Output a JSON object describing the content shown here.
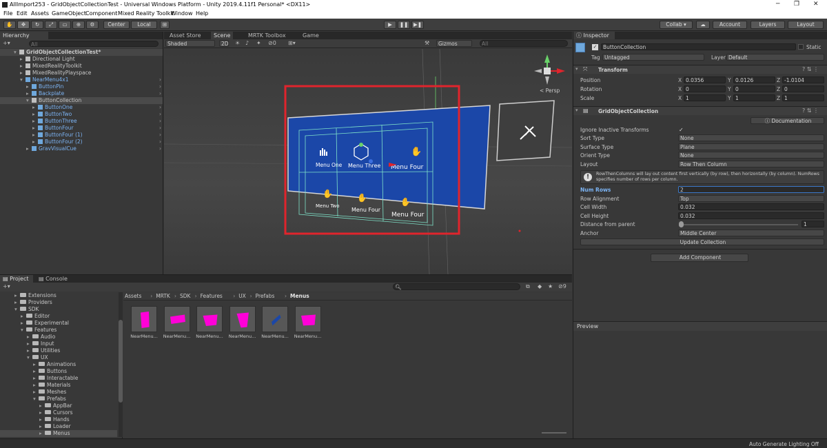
{
  "window": {
    "title": "AllImport253 - GridObjectCollectionTest - Universal Windows Platform - Unity 2019.4.11f1 Personal* <DX11>",
    "controls": [
      "─",
      "❐",
      "✕"
    ]
  },
  "menu": [
    "File",
    "Edit",
    "Assets",
    "GameObject",
    "Component",
    "Mixed Reality Toolkit",
    "Window",
    "Help"
  ],
  "toolbar": {
    "pivot": "Center",
    "space": "Local",
    "collab": "Collab ▾",
    "account": "Account",
    "layers": "Layers",
    "layout": "Layout"
  },
  "hierarchy": {
    "tab": "Hierarchy",
    "search_placeholder": "All",
    "scene": "GridObjectCollectionTest*",
    "items": [
      {
        "label": "Directional Light",
        "depth": 1,
        "prefab": false
      },
      {
        "label": "MixedRealityToolkit",
        "depth": 1,
        "prefab": false
      },
      {
        "label": "MixedRealityPlayspace",
        "depth": 1,
        "prefab": false
      },
      {
        "label": "NearMenu4x1",
        "depth": 1,
        "prefab": true
      },
      {
        "label": "ButtonPin",
        "depth": 2,
        "prefab": true
      },
      {
        "label": "Backplate",
        "depth": 2,
        "prefab": true
      },
      {
        "label": "ButtonCollection",
        "depth": 2,
        "prefab": false
      },
      {
        "label": "ButtonOne",
        "depth": 3,
        "prefab": true
      },
      {
        "label": "ButtonTwo",
        "depth": 3,
        "prefab": true
      },
      {
        "label": "ButtonThree",
        "depth": 3,
        "prefab": true
      },
      {
        "label": "ButtonFour",
        "depth": 3,
        "prefab": true
      },
      {
        "label": "ButtonFour (1)",
        "depth": 3,
        "prefab": true
      },
      {
        "label": "ButtonFour (2)",
        "depth": 3,
        "prefab": true
      },
      {
        "label": "GravVisualCue",
        "depth": 2,
        "prefab": true
      }
    ]
  },
  "scene_tabs": [
    "Asset Store",
    "Scene",
    "MRTK Toolbox",
    "Game"
  ],
  "scene_toolbar": {
    "shading": "Shaded",
    "mode2d": "2D",
    "gizmos": "Gizmos",
    "search_placeholder": "All",
    "persp": "< Persp",
    "hidden_count": "0"
  },
  "scene_buttons": [
    "Menu One",
    "Menu Three",
    "Menu Four",
    "Menu Two",
    "Menu Four",
    "Menu Four"
  ],
  "inspector": {
    "tab": "Inspector",
    "object_name": "ButtonCollection",
    "static_label": "Static",
    "tag_label": "Tag",
    "tag_value": "Untagged",
    "layer_label": "Layer",
    "layer_value": "Default",
    "transform": {
      "title": "Transform",
      "rows": [
        {
          "label": "Position",
          "x": "0.0356",
          "y": "0.0126",
          "z": "-1.0104"
        },
        {
          "label": "Rotation",
          "x": "0",
          "y": "0",
          "z": "0"
        },
        {
          "label": "Scale",
          "x": "1",
          "y": "1",
          "z": "1"
        }
      ]
    },
    "component": {
      "title": "GridObjectCollection",
      "doc_button": "Documentation",
      "ignore_inactive": "Ignore Inactive Transforms",
      "sort_type_label": "Sort Type",
      "sort_type": "None",
      "surface_type_label": "Surface Type",
      "surface_type": "Plane",
      "orient_type_label": "Orient Type",
      "orient_type": "None",
      "layout_label": "Layout",
      "layout": "Row Then Column",
      "help": "RowThenColumns will lay out content first vertically (by row), then horizontally (by column). NumRows specifies number of rows per column.",
      "num_rows_label": "Num Rows",
      "num_rows": "2",
      "row_alignment_label": "Row Alignment",
      "row_alignment": "Top",
      "cell_width_label": "Cell Width",
      "cell_width": "0.032",
      "cell_height_label": "Cell Height",
      "cell_height": "0.032",
      "distance_label": "Distance from parent",
      "distance": "1",
      "distance_fraction": 0.0,
      "anchor_label": "Anchor",
      "anchor": "Middle Center",
      "update_button": "Update Collection"
    },
    "add_component": "Add Component",
    "preview": "Preview"
  },
  "project": {
    "tabs": [
      "Project",
      "Console"
    ],
    "hidden_count": "9",
    "breadcrumb": [
      "Assets",
      "MRTK",
      "SDK",
      "Features",
      "UX",
      "Prefabs",
      "Menus"
    ],
    "tree": [
      {
        "label": "Extensions",
        "depth": 1,
        "open": false
      },
      {
        "label": "Providers",
        "depth": 1,
        "open": false
      },
      {
        "label": "SDK",
        "depth": 1,
        "open": true
      },
      {
        "label": "Editor",
        "depth": 2,
        "open": false
      },
      {
        "label": "Experimental",
        "depth": 2,
        "open": false
      },
      {
        "label": "Features",
        "depth": 2,
        "open": true
      },
      {
        "label": "Audio",
        "depth": 3,
        "open": false
      },
      {
        "label": "Input",
        "depth": 3,
        "open": false
      },
      {
        "label": "Utilities",
        "depth": 3,
        "open": false
      },
      {
        "label": "UX",
        "depth": 3,
        "open": true
      },
      {
        "label": "Animations",
        "depth": 4,
        "open": false
      },
      {
        "label": "Buttons",
        "depth": 4,
        "open": false
      },
      {
        "label": "Interactable",
        "depth": 4,
        "open": false
      },
      {
        "label": "Materials",
        "depth": 4,
        "open": false
      },
      {
        "label": "Meshes",
        "depth": 4,
        "open": false
      },
      {
        "label": "Prefabs",
        "depth": 4,
        "open": true
      },
      {
        "label": "AppBar",
        "depth": 5,
        "open": false
      },
      {
        "label": "Cursors",
        "depth": 5,
        "open": false
      },
      {
        "label": "Hands",
        "depth": 5,
        "open": false
      },
      {
        "label": "Loader",
        "depth": 5,
        "open": false
      },
      {
        "label": "Menus",
        "depth": 5,
        "open": false
      }
    ],
    "assets": [
      "NearMenu...",
      "NearMenu...",
      "NearMenu...",
      "NearMenu...",
      "NearMenu...",
      "NearMenu..."
    ]
  },
  "status": "Auto Generate Lighting Off",
  "colors": {
    "highlight": "#e0242c",
    "menu_blue": "#1b47a8",
    "asset_magenta": "#ff00d8"
  }
}
